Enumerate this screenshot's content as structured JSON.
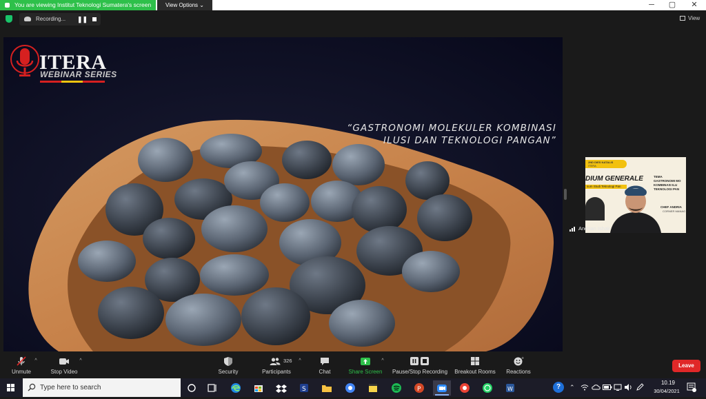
{
  "titlebar": {
    "share_banner": "You are viewing Institut Teknologi Sumatera's screen",
    "view_options": "View Options ⌄",
    "minimize": "─",
    "maximize": "▢",
    "close": "✕"
  },
  "topbar": {
    "recording_text": "Recording...",
    "pause": "❚❚",
    "view_label": "View"
  },
  "slide": {
    "logo_title": "ITERA",
    "logo_sub": "WEBINAR SERIES",
    "quote_line1": "“GASTRONOMI MOLEKULER KOMBINASI",
    "quote_line2": "ILUSI DAN TEKNOLOGI PANGAN”"
  },
  "speaker": {
    "name": "Andrian Ishak",
    "banner_top": "2ND DIES NATALIS",
    "banner_sub": "ITERA",
    "banner_title": "DIUM GENERALE",
    "banner_line": "sum Studi Teknologi Pan",
    "tema_label": "TEMA",
    "tema_text1": "GASTRONOMI MO",
    "tema_text2": "KOMBINASI ILU",
    "tema_text3": "TEKNOLOGI PAN",
    "chef": "CHEF ANDRIA",
    "chef_sub": "CORNER MANAG"
  },
  "toolbar": {
    "unmute": "Unmute",
    "stop_video": "Stop Video",
    "security": "Security",
    "participants": "Participants",
    "participants_count": "326",
    "chat": "Chat",
    "share_screen": "Share Screen",
    "pause_recording": "Pause/Stop Recording",
    "breakout": "Breakout Rooms",
    "reactions": "Reactions",
    "leave": "Leave",
    "caret": "^"
  },
  "taskbar": {
    "search_placeholder": "Type here to search",
    "time": "10.19",
    "date": "30/04/2021"
  },
  "colors": {
    "zoom_green": "#2ec04a",
    "leave_red": "#e02828",
    "taskbar_bg": "#1c1c28"
  }
}
